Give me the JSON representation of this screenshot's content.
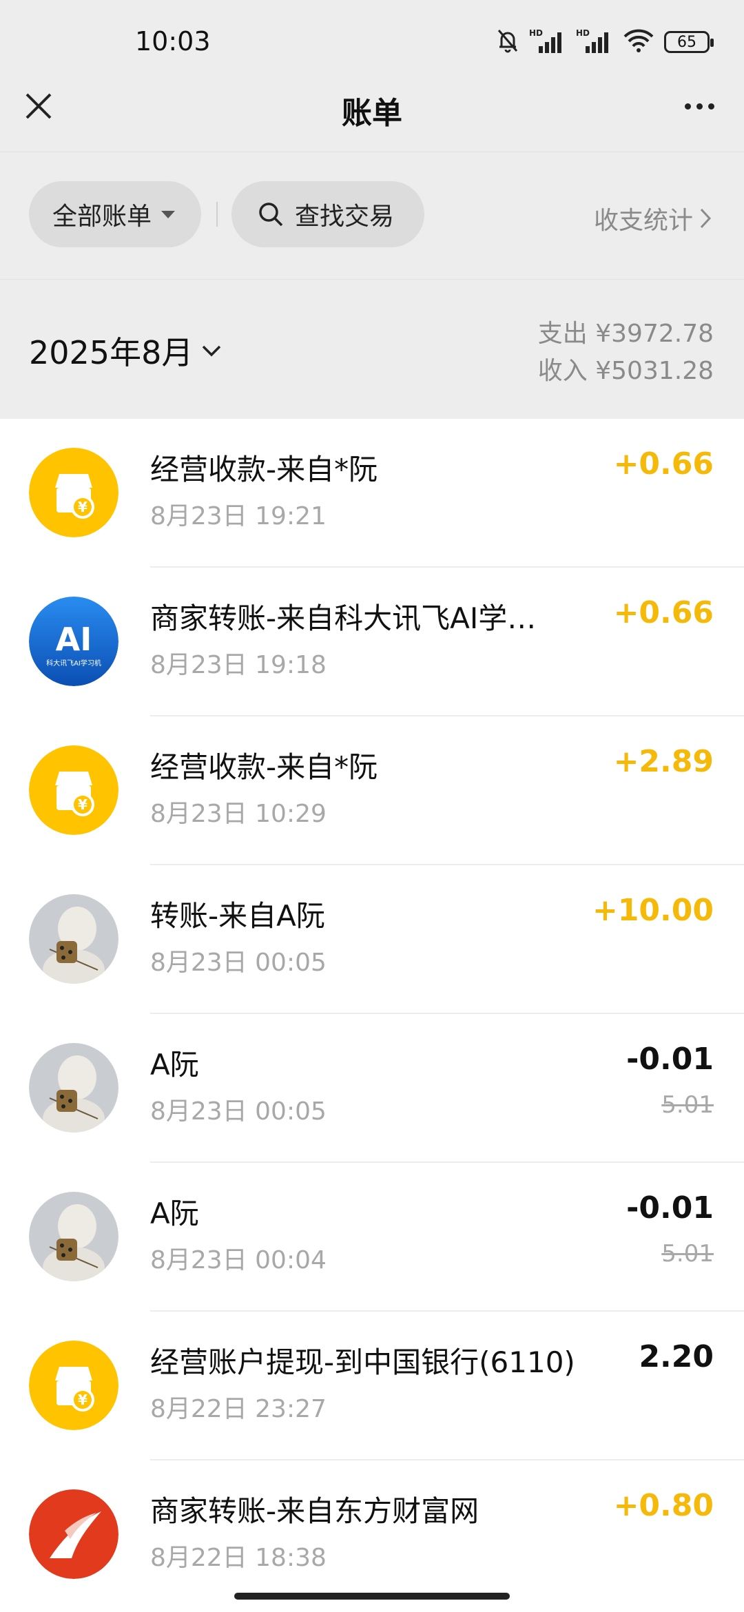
{
  "status_bar": {
    "time": "10:03",
    "battery": "65",
    "icons": [
      "mute-bell-icon",
      "hd-signal-icon",
      "hd-signal-icon",
      "wifi-icon",
      "battery-icon"
    ]
  },
  "header": {
    "title": "账单",
    "close_icon": "close-icon",
    "more_icon": "more-icon"
  },
  "filters": {
    "all_bills": "全部账单",
    "search": "查找交易",
    "stats": "收支统计"
  },
  "month": {
    "label": "2025年8月",
    "expense": "支出 ¥3972.78",
    "income": "收入 ¥5031.28"
  },
  "colors": {
    "income": "#f5b90a",
    "merchant_yellow": "#ffc300",
    "ai_blue": "#1a6fd6",
    "eastmoney_red": "#e23a1c",
    "background": "#ededed"
  },
  "transactions": [
    {
      "title": "经营收款-来自*阮",
      "date": "8月23日 19:21",
      "amount": "+0.66",
      "type": "income",
      "avatar": "merchant-icon"
    },
    {
      "title": "商家转账-来自科大讯飞AI学…",
      "date": "8月23日 19:18",
      "amount": "+0.66",
      "type": "income",
      "avatar": "iflytek-ai-logo",
      "avatar_text": "AI",
      "avatar_sub": "科大讯飞AI学习机"
    },
    {
      "title": "经营收款-来自*阮",
      "date": "8月23日 10:29",
      "amount": "+2.89",
      "type": "income",
      "avatar": "merchant-icon"
    },
    {
      "title": "转账-来自A阮",
      "date": "8月23日 00:05",
      "amount": "+10.00",
      "type": "income",
      "avatar": "user-photo"
    },
    {
      "title": "A阮",
      "date": "8月23日 00:05",
      "amount": "-0.01",
      "original": "5.01",
      "type": "expense",
      "avatar": "user-photo"
    },
    {
      "title": "A阮",
      "date": "8月23日 00:04",
      "amount": "-0.01",
      "original": "5.01",
      "type": "expense",
      "avatar": "user-photo"
    },
    {
      "title": "经营账户提现-到中国银行(6110)",
      "date": "8月22日 23:27",
      "amount": "2.20",
      "type": "neutral",
      "avatar": "merchant-icon"
    },
    {
      "title": "商家转账-来自东方财富网",
      "date": "8月22日 18:38",
      "amount": "+0.80",
      "type": "income",
      "avatar": "eastmoney-logo"
    }
  ]
}
